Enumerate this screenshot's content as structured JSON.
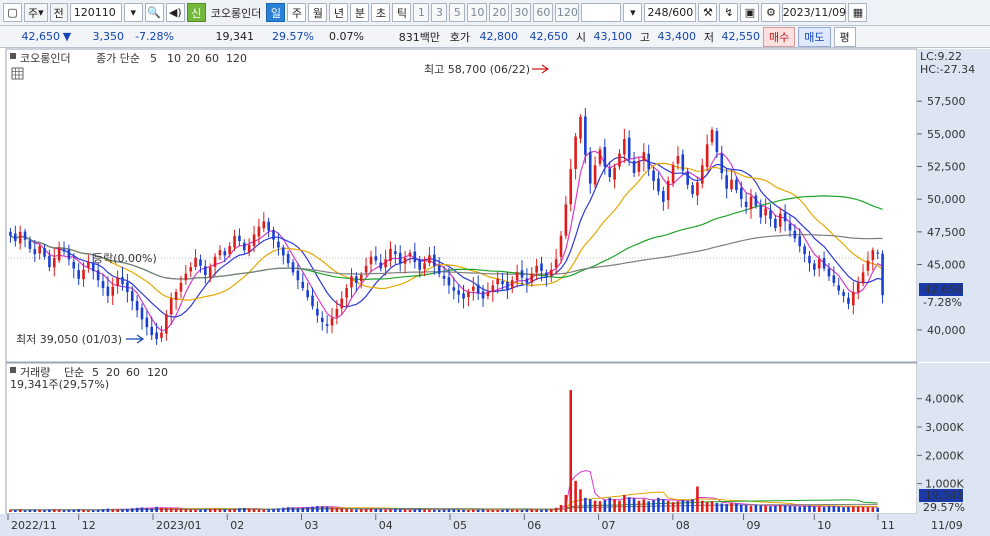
{
  "toolbar": {
    "market": "주",
    "period_label": "전",
    "code": "120110",
    "credit_label": "신",
    "company": "코오롱인더",
    "period_tabs": [
      "일",
      "주",
      "월",
      "년",
      "분",
      "초",
      "틱"
    ],
    "active_tab": "일",
    "intervals": [
      "1",
      "3",
      "5",
      "10",
      "20",
      "30",
      "60",
      "120"
    ],
    "count": "248/600",
    "date": "2023/11/09"
  },
  "quote": {
    "price": "42,650",
    "direction_symbol": "▼",
    "change": "3,350",
    "change_pct": "-7.28%",
    "volume": "19,341",
    "volume_ratio": "29.57%",
    "turnover_pct": "0.07%",
    "amount": "831백만",
    "bid_label": "호가",
    "bid": "42,800",
    "ask": "42,650",
    "open_label": "시",
    "open": "43,100",
    "high_label": "고",
    "high": "43,400",
    "low_label": "저",
    "low": "42,550",
    "buy_label": "매수",
    "sell_label": "매도",
    "eval_label": "평"
  },
  "price_legend": {
    "name": "코오롱인더",
    "type": "종가 단순",
    "periods": [
      "5",
      "10",
      "20",
      "60",
      "120"
    ],
    "colors": [
      "#d53cc8",
      "#2f39d8",
      "#e6a800",
      "#1fa22a",
      "#7f7f7f"
    ]
  },
  "volume_legend": {
    "label": "거래량",
    "type": "단순",
    "periods": [
      "5",
      "20",
      "60",
      "120"
    ],
    "current": "19,341주(29,57%)"
  },
  "annotations": {
    "high_marker": "최고 58,700 (06/22)",
    "low_marker": "최저 39,050 (01/03)",
    "price_tag": "42,650",
    "price_tag_pct": "-7.28%",
    "vol_tag": "19,341",
    "vol_tag_pct": "29.57%",
    "lc": "LC:9.22",
    "hc": "HC:-27.34",
    "ref_line": "등락(0.00%)"
  },
  "chart_data": {
    "type": "candlestick",
    "x_labels": [
      "2022/11",
      "12",
      "2023/01",
      "02",
      "03",
      "04",
      "05",
      "06",
      "07",
      "08",
      "09",
      "10",
      "11",
      "11/09"
    ],
    "price_axis_ticks": [
      "57,500",
      "55,000",
      "52,500",
      "50,000",
      "47,500",
      "45,000",
      "42,650",
      "40,000"
    ],
    "volume_axis_ticks": [
      "4,000K",
      "3,000K",
      "2,000K",
      "1,000K"
    ],
    "price_range": [
      38000,
      60500
    ],
    "volume_range": [
      0,
      4800
    ],
    "series_colors": {
      "up": "#e01b1b",
      "down": "#1b3fd1"
    },
    "closes": [
      47200,
      46800,
      47500,
      46900,
      46200,
      45800,
      46400,
      45600,
      44800,
      45500,
      46300,
      46000,
      45400,
      44700,
      43900,
      44600,
      45200,
      44500,
      43800,
      43200,
      42600,
      43300,
      44000,
      43500,
      42900,
      42200,
      41500,
      40800,
      40200,
      39600,
      39300,
      39800,
      41200,
      42400,
      42900,
      43600,
      44300,
      44800,
      45500,
      44900,
      44200,
      44800,
      45600,
      46100,
      45700,
      46400,
      47200,
      46800,
      46100,
      46500,
      47300,
      47900,
      48300,
      47600,
      46900,
      46300,
      45700,
      45100,
      44400,
      43800,
      43200,
      42500,
      41800,
      41100,
      40600,
      40300,
      40900,
      41600,
      42400,
      43200,
      44100,
      43600,
      44200,
      44900,
      45600,
      45300,
      44700,
      45400,
      46200,
      45800,
      45100,
      45500,
      45900,
      45200,
      44600,
      45100,
      45700,
      44900,
      44300,
      43900,
      43400,
      43000,
      42700,
      42400,
      42900,
      43300,
      42800,
      42400,
      42900,
      43400,
      43900,
      43500,
      43100,
      43800,
      44400,
      44000,
      43600,
      44300,
      44900,
      44500,
      44100,
      44600,
      45400,
      47200,
      49600,
      52300,
      54800,
      56300,
      53400,
      51200,
      52600,
      53800,
      52500,
      51700,
      52400,
      53500,
      54600,
      53100,
      52000,
      52900,
      53600,
      52300,
      51400,
      50600,
      49800,
      51400,
      52600,
      53300,
      52200,
      51100,
      50400,
      51300,
      52600,
      54200,
      55300,
      53600,
      52000,
      50800,
      51500,
      50700,
      50000,
      49400,
      50200,
      49500,
      48600,
      49300,
      48500,
      47800,
      48900,
      48300,
      47600,
      47000,
      46400,
      45800,
      45100,
      44600,
      45400,
      44700,
      44100,
      43600,
      43000,
      42600,
      42000,
      42900,
      43600,
      44400,
      45300,
      46100,
      45900,
      42650
    ],
    "volumes_k": [
      80,
      70,
      90,
      60,
      75,
      80,
      70,
      65,
      85,
      90,
      70,
      60,
      75,
      80,
      95,
      70,
      60,
      65,
      80,
      100,
      120,
      90,
      85,
      95,
      110,
      130,
      150,
      160,
      140,
      120,
      180,
      150,
      140,
      130,
      120,
      110,
      100,
      95,
      90,
      85,
      100,
      110,
      120,
      105,
      95,
      90,
      110,
      130,
      140,
      120,
      100,
      90,
      85,
      95,
      110,
      130,
      150,
      170,
      160,
      140,
      150,
      170,
      190,
      210,
      200,
      180,
      160,
      140,
      120,
      110,
      100,
      90,
      95,
      110,
      120,
      100,
      90,
      85,
      95,
      100,
      90,
      85,
      80,
      90,
      100,
      95,
      85,
      80,
      75,
      85,
      95,
      90,
      80,
      75,
      70,
      80,
      85,
      90,
      80,
      75,
      70,
      80,
      90,
      85,
      80,
      75,
      90,
      95,
      85,
      80,
      90,
      100,
      150,
      250,
      600,
      4300,
      1100,
      800,
      500,
      450,
      400,
      380,
      420,
      500,
      450,
      400,
      600,
      520,
      480,
      400,
      450,
      380,
      420,
      500,
      450,
      400,
      350,
      380,
      420,
      400,
      450,
      900,
      400,
      350,
      380,
      320,
      300,
      280,
      320,
      300,
      260,
      240,
      220,
      250,
      230,
      210,
      200,
      220,
      240,
      230,
      210,
      200,
      190,
      210,
      220,
      200,
      190,
      180,
      200,
      210,
      190,
      170,
      180,
      200,
      190,
      180,
      170,
      160,
      150
    ]
  }
}
